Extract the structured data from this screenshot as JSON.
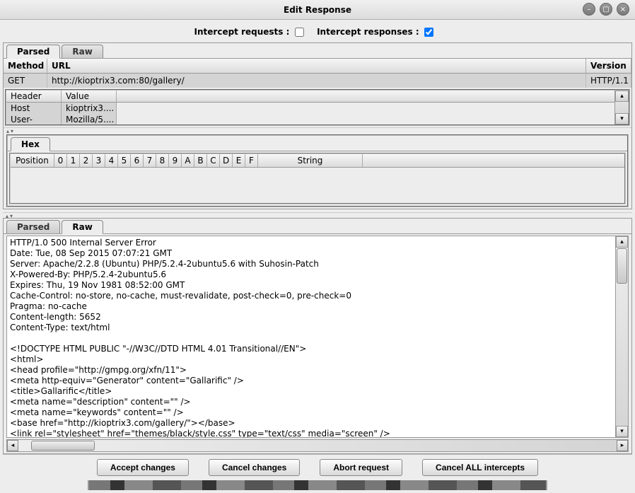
{
  "window": {
    "title": "Edit Response"
  },
  "intercept": {
    "requests_label": "Intercept requests :",
    "requests_checked": false,
    "responses_label": "Intercept responses :",
    "responses_checked": true
  },
  "request_tabs": {
    "parsed": "Parsed",
    "raw": "Raw",
    "active": "parsed"
  },
  "request_columns": {
    "method": "Method",
    "url": "URL",
    "version": "Version"
  },
  "request_row": {
    "method": "GET",
    "url": "http://kioptrix3.com:80/gallery/",
    "version": "HTTP/1.1"
  },
  "headers_columns": {
    "name": "Header",
    "value": "Value"
  },
  "headers": [
    {
      "name": "Host",
      "value": "kioptrix3...."
    },
    {
      "name": "User-Agent",
      "value": "Mozilla/5...."
    }
  ],
  "hex": {
    "tab": "Hex",
    "position": "Position",
    "nibbles": [
      "0",
      "1",
      "2",
      "3",
      "4",
      "5",
      "6",
      "7",
      "8",
      "9",
      "A",
      "B",
      "C",
      "D",
      "E",
      "F"
    ],
    "string": "String"
  },
  "response_tabs": {
    "parsed": "Parsed",
    "raw": "Raw",
    "active": "raw"
  },
  "response_raw": "HTTP/1.0 500 Internal Server Error\nDate: Tue, 08 Sep 2015 07:07:21 GMT\nServer: Apache/2.2.8 (Ubuntu) PHP/5.2.4-2ubuntu5.6 with Suhosin-Patch\nX-Powered-By: PHP/5.2.4-2ubuntu5.6\nExpires: Thu, 19 Nov 1981 08:52:00 GMT\nCache-Control: no-store, no-cache, must-revalidate, post-check=0, pre-check=0\nPragma: no-cache\nContent-length: 5652\nContent-Type: text/html\n\n<!DOCTYPE HTML PUBLIC \"-//W3C//DTD HTML 4.01 Transitional//EN\">\n<html>\n<head profile=\"http://gmpg.org/xfn/11\">\n<meta http-equiv=\"Generator\" content=\"Gallarific\" />\n<title>Gallarific</title>\n<meta name=\"description\" content=\"\" />\n<meta name=\"keywords\" content=\"\" />\n<base href=\"http://kioptrix3.com/gallery/\"></base>\n<link rel=\"stylesheet\" href=\"themes/black/style.css\" type=\"text/css\" media=\"screen\" />",
  "buttons": {
    "accept": "Accept changes",
    "cancel": "Cancel changes",
    "abort": "Abort request",
    "cancel_all": "Cancel ALL intercepts"
  }
}
